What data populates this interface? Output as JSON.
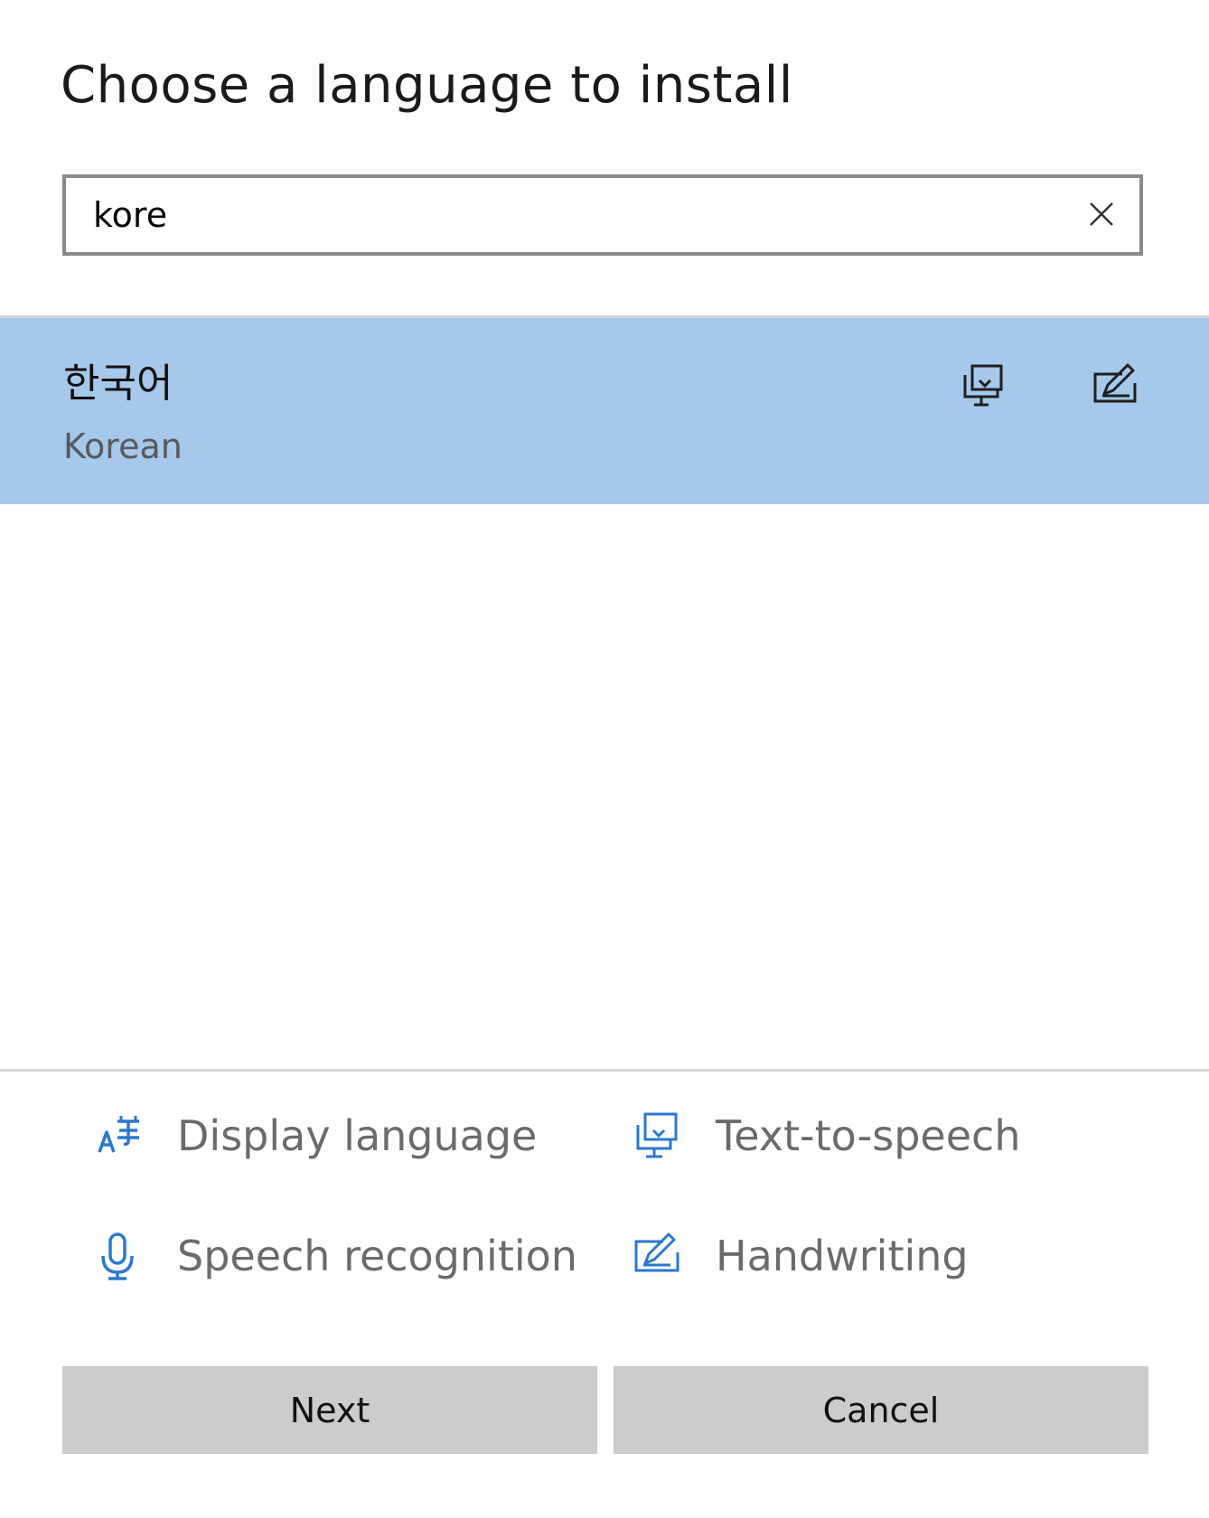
{
  "dialog": {
    "title": "Choose a language to install"
  },
  "search": {
    "value": "kore",
    "clear_icon": "close-icon"
  },
  "results": [
    {
      "native_name": "한국어",
      "english_name": "Korean",
      "feature_icons": [
        "text-to-speech-icon",
        "handwriting-icon"
      ],
      "selected": true
    }
  ],
  "legend": {
    "display_language": {
      "label": "Display language",
      "icon": "display-language-icon"
    },
    "text_to_speech": {
      "label": "Text-to-speech",
      "icon": "text-to-speech-icon"
    },
    "speech_recognition": {
      "label": "Speech recognition",
      "icon": "microphone-icon"
    },
    "handwriting": {
      "label": "Handwriting",
      "icon": "handwriting-icon"
    }
  },
  "buttons": {
    "next": "Next",
    "cancel": "Cancel"
  },
  "colors": {
    "selection": "#a6c8ea",
    "accent": "#2b78d0",
    "button": "#cccccc"
  }
}
